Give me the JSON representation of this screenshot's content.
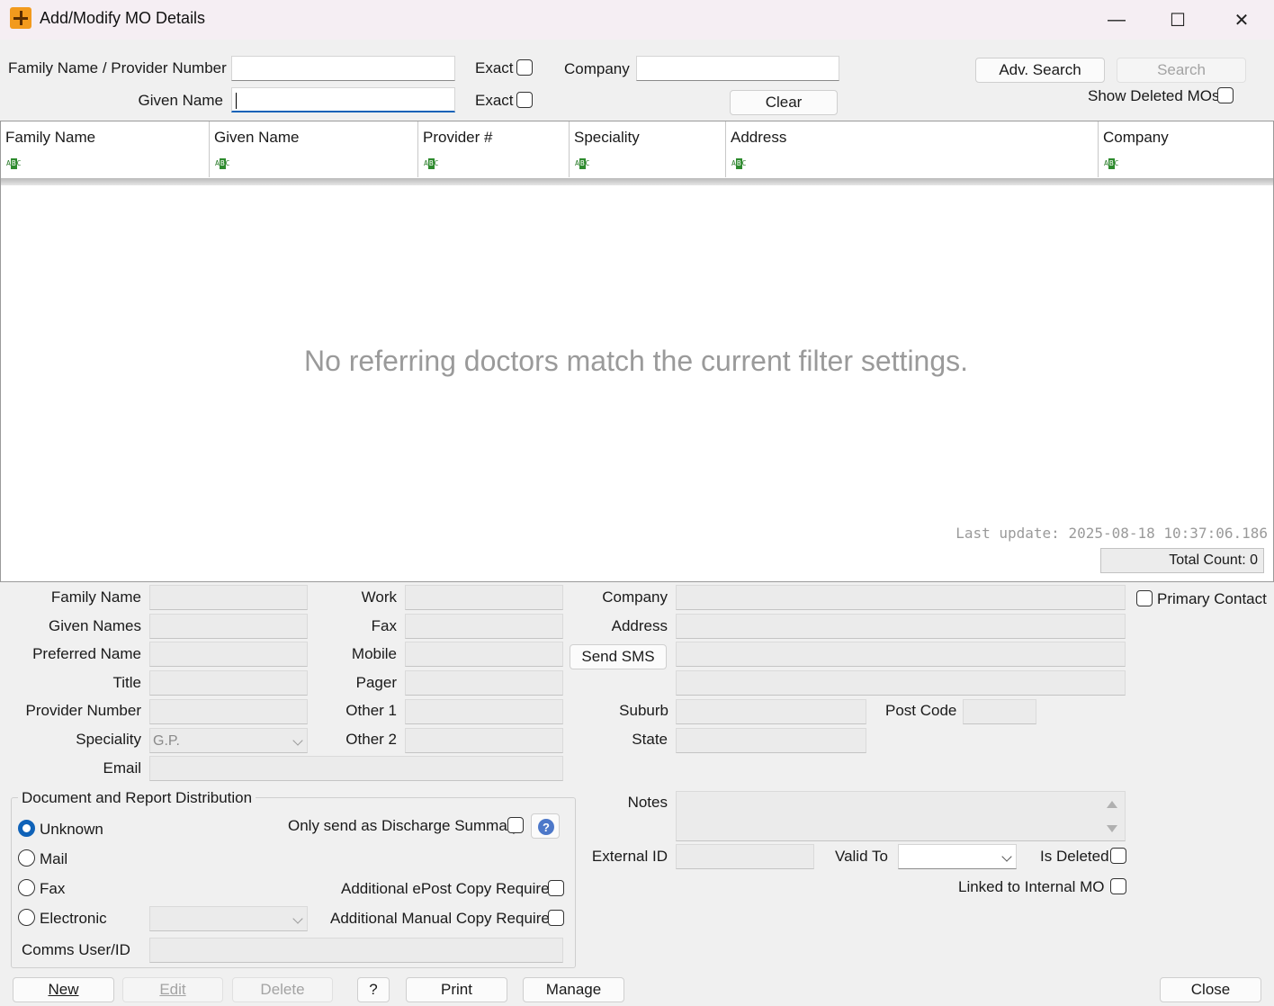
{
  "window": {
    "title": "Add/Modify MO Details",
    "controls": {
      "minimize": "—",
      "maximize": "☐",
      "close": "✕"
    }
  },
  "search": {
    "family_label": "Family Name / Provider Number",
    "given_label": "Given Name",
    "exact_label": "Exact",
    "company_label": "Company",
    "adv_search": "Adv. Search",
    "search": "Search",
    "clear": "Clear",
    "show_deleted": "Show Deleted MOs"
  },
  "grid": {
    "columns": [
      "Family Name",
      "Given Name",
      "Provider #",
      "Speciality",
      "Address",
      "Company"
    ],
    "filter_icon": "abc-filter-icon",
    "empty_message": "No referring doctors match the current filter settings.",
    "last_update": "Last update: 2025-08-18 10:37:06.186",
    "total_count": "Total Count: 0"
  },
  "details": {
    "family_name": "Family Name",
    "given_names": "Given Names",
    "preferred_name": "Preferred Name",
    "title": "Title",
    "provider_number": "Provider Number",
    "speciality": "Speciality",
    "speciality_value": "G.P.",
    "email": "Email",
    "work": "Work",
    "fax": "Fax",
    "mobile": "Mobile",
    "pager": "Pager",
    "other1": "Other 1",
    "other2": "Other 2",
    "company": "Company",
    "address": "Address",
    "send_sms": "Send SMS",
    "suburb": "Suburb",
    "post_code": "Post Code",
    "state": "State",
    "primary_contact": "Primary Contact",
    "notes": "Notes",
    "external_id": "External ID",
    "valid_to": "Valid To",
    "is_deleted": "Is Deleted",
    "linked_internal": "Linked to Internal MO"
  },
  "distribution": {
    "title": "Document and Report Distribution",
    "unknown": "Unknown",
    "mail": "Mail",
    "fax": "Fax",
    "electronic": "Electronic",
    "only_discharge": "Only send as Discharge Summary",
    "epost_copy": "Additional ePost Copy Required",
    "manual_copy": "Additional Manual Copy Required",
    "comms_user": "Comms User/ID",
    "selected": "Unknown"
  },
  "footer": {
    "new": "New",
    "edit": "Edit",
    "delete": "Delete",
    "help": "?",
    "print": "Print",
    "manage": "Manage",
    "close": "Close"
  },
  "colors": {
    "accent": "#0f62b8",
    "title_bar": "#f5eef3",
    "app_icon": "#f29a1d"
  }
}
